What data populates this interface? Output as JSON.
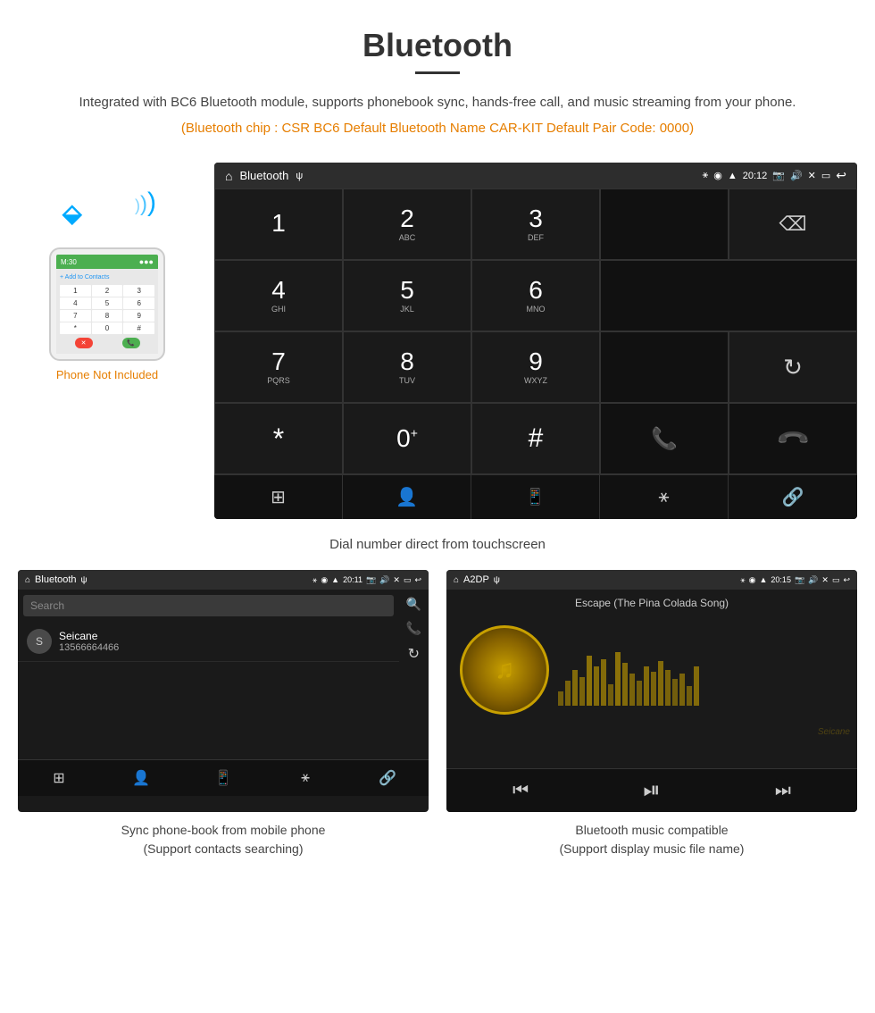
{
  "header": {
    "title": "Bluetooth",
    "description": "Integrated with BC6 Bluetooth module, supports phonebook sync, hands-free call, and music streaming from your phone.",
    "specs": "(Bluetooth chip : CSR BC6   Default Bluetooth Name CAR-KIT    Default Pair Code: 0000)"
  },
  "car_screen": {
    "status_bar": {
      "home_icon": "home",
      "title": "Bluetooth",
      "usb_icon": "usb",
      "bt_icon": "bluetooth",
      "loc_icon": "location",
      "signal_icon": "signal",
      "time": "20:12",
      "cam_icon": "camera",
      "vol_icon": "volume",
      "x_icon": "close",
      "win_icon": "window",
      "back_icon": "back"
    },
    "dialpad": {
      "keys": [
        {
          "num": "1",
          "sub": ""
        },
        {
          "num": "2",
          "sub": "ABC"
        },
        {
          "num": "3",
          "sub": "DEF"
        },
        {
          "num": "",
          "sub": ""
        },
        {
          "num": "",
          "sub": "backspace"
        },
        {
          "num": "4",
          "sub": "GHI"
        },
        {
          "num": "5",
          "sub": "JKL"
        },
        {
          "num": "6",
          "sub": "MNO"
        },
        {
          "num": "",
          "sub": ""
        },
        {
          "num": "",
          "sub": ""
        },
        {
          "num": "7",
          "sub": "PQRS"
        },
        {
          "num": "8",
          "sub": "TUV"
        },
        {
          "num": "9",
          "sub": "WXYZ"
        },
        {
          "num": "",
          "sub": ""
        },
        {
          "num": "",
          "sub": "refresh"
        },
        {
          "num": "*",
          "sub": ""
        },
        {
          "num": "0",
          "sub": "+"
        },
        {
          "num": "#",
          "sub": ""
        },
        {
          "num": "",
          "sub": "call-green"
        },
        {
          "num": "",
          "sub": "call-red"
        }
      ]
    },
    "bottom_nav": [
      "grid",
      "person",
      "phone",
      "bluetooth",
      "link"
    ]
  },
  "caption_main": "Dial number direct from touchscreen",
  "phone_section": {
    "not_included_text": "Phone Not Included"
  },
  "phonebook_screen": {
    "title": "Bluetooth",
    "time": "20:11",
    "search_placeholder": "Search",
    "contact": {
      "initial": "S",
      "name": "Seicane",
      "number": "13566664466"
    },
    "bottom_nav": [
      "grid",
      "person-yellow",
      "phone",
      "bluetooth",
      "link"
    ]
  },
  "music_screen": {
    "title": "A2DP",
    "time": "20:15",
    "song_title": "Escape (The Pina Colada Song)",
    "eq_bars": [
      20,
      35,
      50,
      40,
      60,
      45,
      55,
      30,
      65,
      50,
      40,
      35,
      55,
      45,
      60,
      50,
      35,
      45,
      30,
      55
    ],
    "controls": [
      "prev",
      "play-pause",
      "next"
    ]
  },
  "caption_phonebook": "Sync phone-book from mobile phone\n(Support contacts searching)",
  "caption_music": "Bluetooth music compatible\n(Support display music file name)",
  "watermark": "Seicane"
}
